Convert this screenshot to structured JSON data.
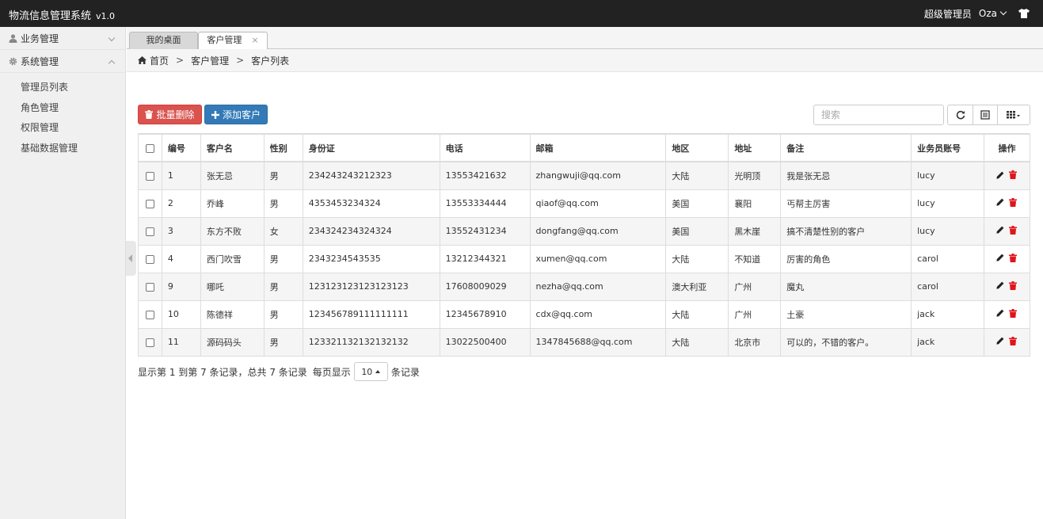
{
  "app": {
    "title": "物流信息管理系统",
    "version": "v1.0"
  },
  "topbar": {
    "role": "超级管理员",
    "user": "Oza"
  },
  "sidebar": {
    "groups": [
      {
        "label": "业务管理",
        "expanded": false
      },
      {
        "label": "系统管理",
        "expanded": true
      }
    ],
    "items": [
      "管理员列表",
      "角色管理",
      "权限管理",
      "基础数据管理"
    ]
  },
  "tabs": [
    {
      "label": "我的桌面",
      "active": false
    },
    {
      "label": "客户管理",
      "active": true,
      "close": "×"
    }
  ],
  "breadcrumb": [
    "首页",
    "客户管理",
    "客户列表"
  ],
  "toolbar": {
    "batch_delete": "批量删除",
    "add_customer": "添加客户",
    "search_placeholder": "搜索"
  },
  "table": {
    "columns": [
      "编号",
      "客户名",
      "性别",
      "身份证",
      "电话",
      "邮箱",
      "地区",
      "地址",
      "备注",
      "业务员账号",
      "操作"
    ],
    "rows": [
      [
        "1",
        "张无忌",
        "男",
        "234243243212323",
        "13553421632",
        "zhangwuji@qq.com",
        "大陆",
        "光明顶",
        "我是张无忌",
        "lucy"
      ],
      [
        "2",
        "乔峰",
        "男",
        "4353453234324",
        "13553334444",
        "qiaof@qq.com",
        "美国",
        "襄阳",
        "丐帮主厉害",
        "lucy"
      ],
      [
        "3",
        "东方不败",
        "女",
        "234324234324324",
        "13552431234",
        "dongfang@qq.com",
        "美国",
        "黑木崖",
        "搞不清楚性别的客户",
        "lucy"
      ],
      [
        "4",
        "西门吹雪",
        "男",
        "2343234543535",
        "13212344321",
        "xumen@qq.com",
        "大陆",
        "不知道",
        "厉害的角色",
        "carol"
      ],
      [
        "9",
        "哪吒",
        "男",
        "123123123123123123",
        "17608009029",
        "nezha@qq.com",
        "澳大利亚",
        "广州",
        "魔丸",
        "carol"
      ],
      [
        "10",
        "陈德祥",
        "男",
        "123456789111111111",
        "12345678910",
        "cdx@qq.com",
        "大陆",
        "广州",
        "土豪",
        "jack"
      ],
      [
        "11",
        "源码码头",
        "男",
        "123321132132132132",
        "13022500400",
        "1347845688@qq.com",
        "大陆",
        "北京市",
        "可以的，不错的客户。",
        "jack"
      ]
    ]
  },
  "pager": {
    "summary": "显示第 1 到第 7 条记录，总共 7 条记录",
    "per_page_label": "每页显示",
    "page_size": "10",
    "suffix": "条记录"
  },
  "colors": {
    "topbar": "#222222",
    "danger": "#d9534f",
    "primary": "#337ab7",
    "delete_icon": "#e0151b"
  }
}
